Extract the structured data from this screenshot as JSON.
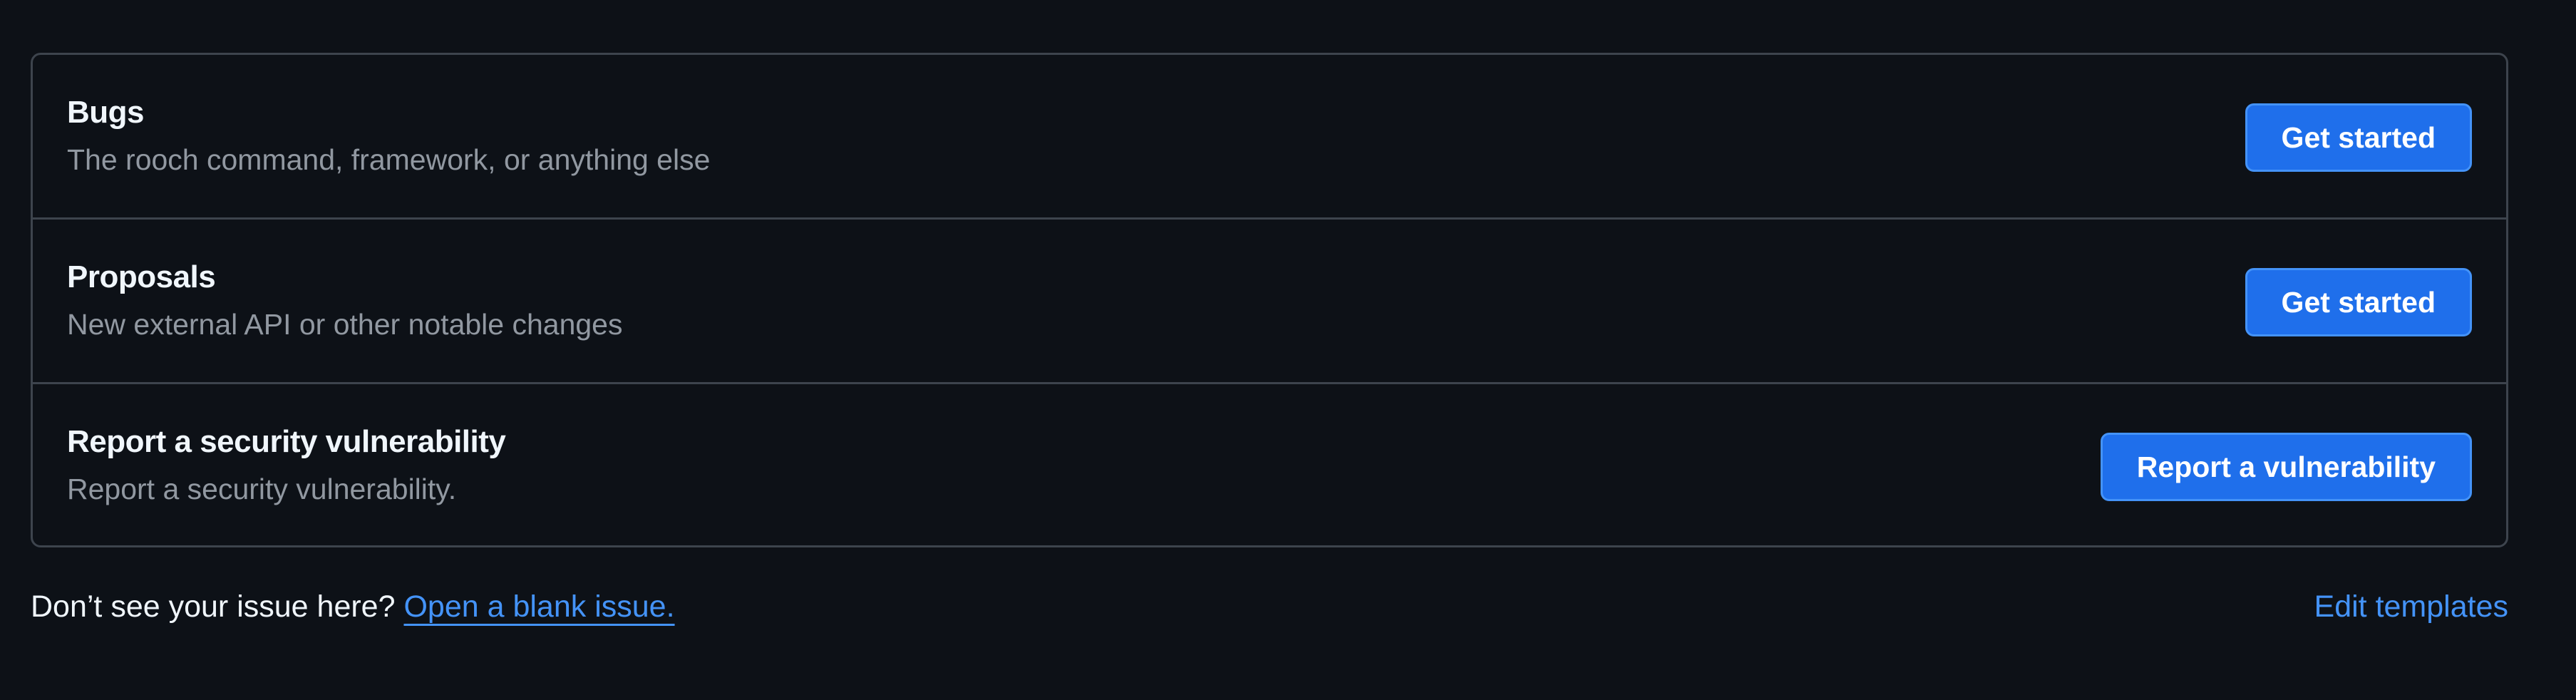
{
  "templates": [
    {
      "title": "Bugs",
      "description": "The rooch command, framework, or anything else",
      "button_label": "Get started"
    },
    {
      "title": "Proposals",
      "description": "New external API or other notable changes",
      "button_label": "Get started"
    },
    {
      "title": "Report a security vulnerability",
      "description": "Report a security vulnerability.",
      "button_label": "Report a vulnerability"
    }
  ],
  "footer": {
    "prompt": "Don’t see your issue here?",
    "blank_issue_link": "Open a blank issue.",
    "edit_templates_link": "Edit templates"
  },
  "colors": {
    "background": "#0d1117",
    "border": "#3d444d",
    "primary_button": "#1f6feb",
    "link": "#4493f8",
    "muted_text": "#9198a1"
  }
}
